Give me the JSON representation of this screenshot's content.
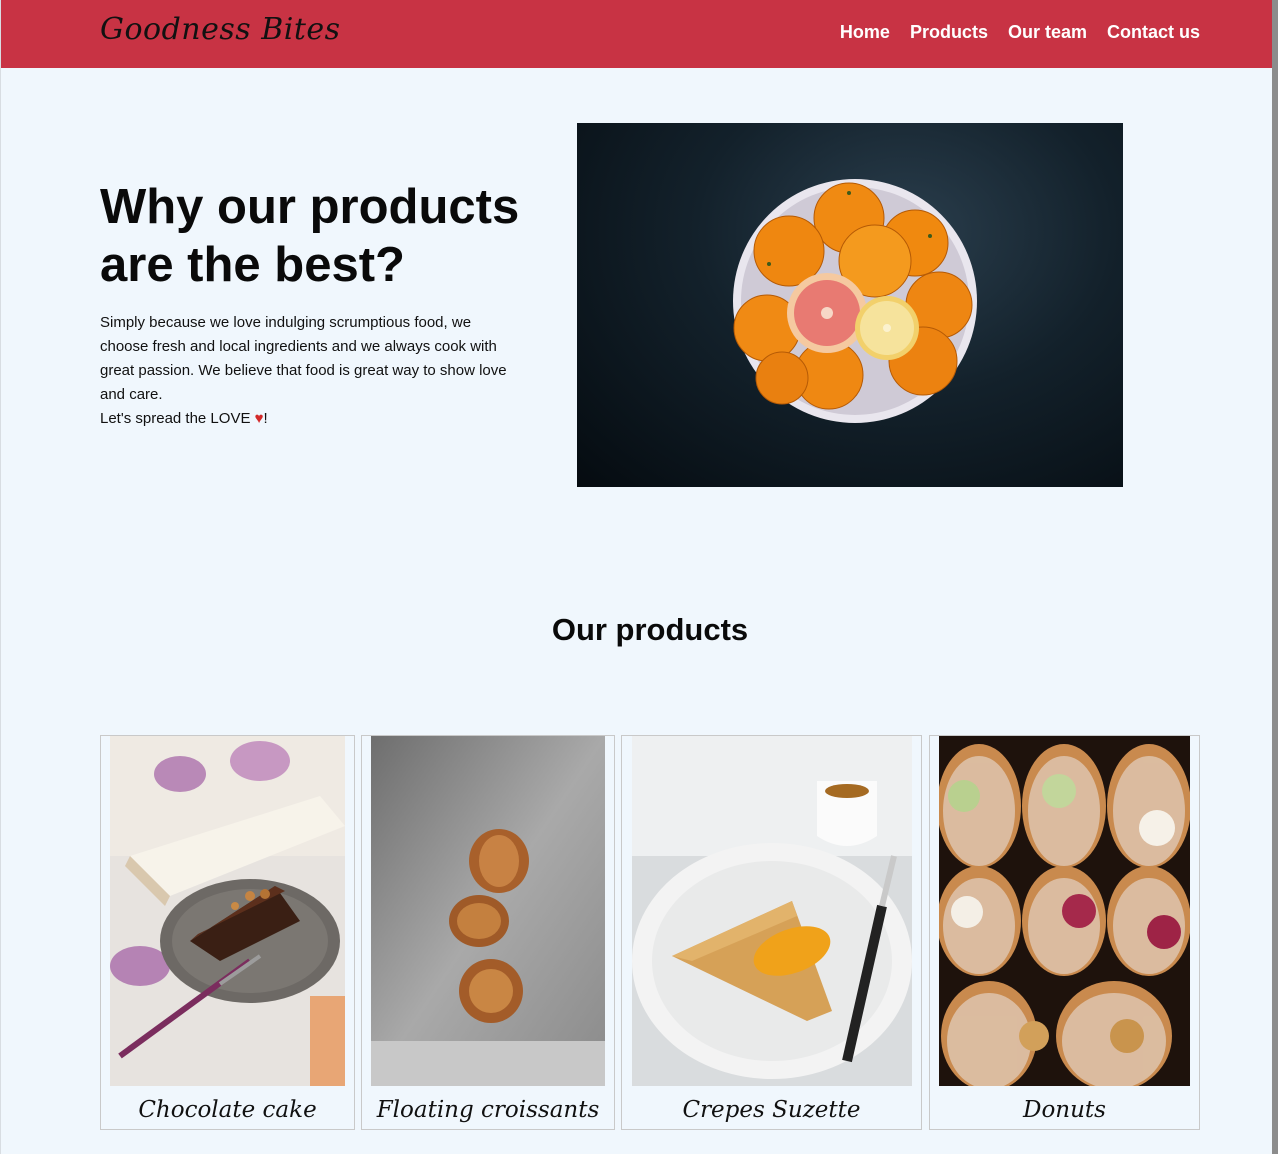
{
  "navbar": {
    "brand": "Goodness Bites",
    "links": [
      "Home",
      "Products",
      "Our team",
      "Contact us"
    ],
    "background_color": "#c83344"
  },
  "hero": {
    "title": "Why our products are the best?",
    "paragraph": "Simply because we love indulging scrumptious food, we choose fresh and local ingredients and we always cook with great passion. We believe that food is great way to show love and care.",
    "spread_love_prefix": "Let's spread the LOVE ",
    "heart_glyph": "♥",
    "spread_love_suffix": "!",
    "image_icon": "bowl-of-oranges-photo"
  },
  "products": {
    "title": "Our products",
    "items": [
      {
        "label": "Chocolate cake",
        "icon": "chocolate-cake-photo"
      },
      {
        "label": "Floating croissants",
        "icon": "croissants-photo"
      },
      {
        "label": "Crepes Suzette",
        "icon": "crepes-photo"
      },
      {
        "label": "Donuts",
        "icon": "donuts-photo"
      }
    ]
  }
}
